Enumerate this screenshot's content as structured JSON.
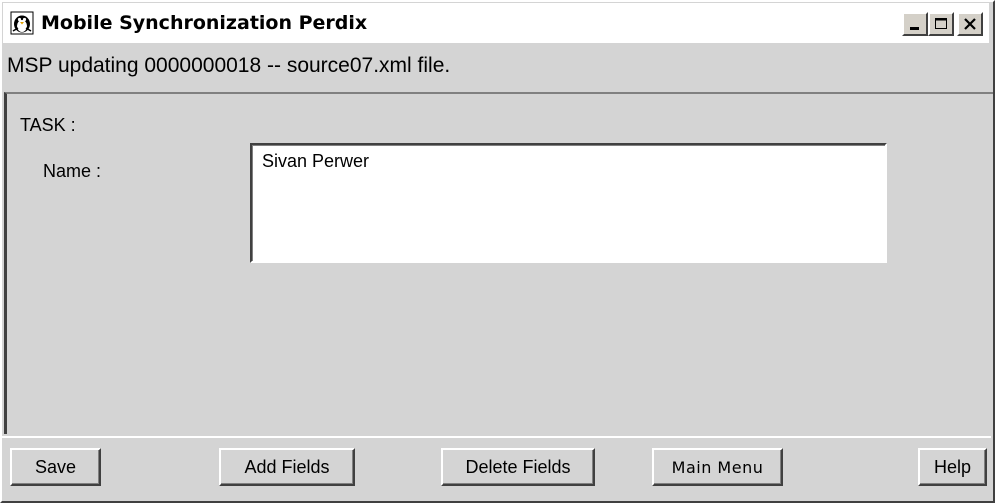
{
  "window": {
    "title": "Mobile Synchronization Perdix",
    "app_icon": "penguin-app-icon",
    "controls": {
      "minimize_icon": "minimize-icon",
      "maximize_icon": "maximize-icon",
      "close_icon": "close-icon"
    }
  },
  "status": {
    "message": "MSP updating 0000000018 --  source07.xml  file."
  },
  "form": {
    "section_label": "TASK :",
    "name_label": "Name :",
    "name_value": "Sivan Perwer"
  },
  "buttons": {
    "save": "Save",
    "add_fields": "Add Fields",
    "delete_fields": "Delete Fields",
    "main_menu": "Main Menu",
    "help": "Help"
  }
}
